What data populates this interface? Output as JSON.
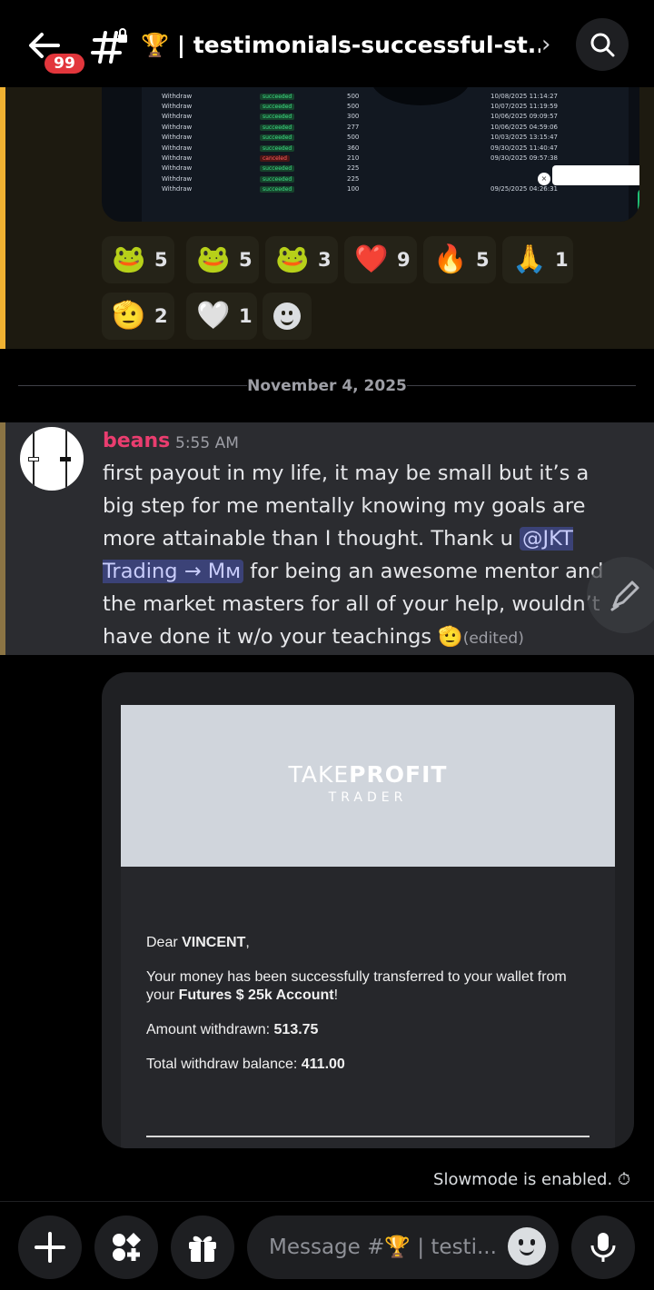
{
  "header": {
    "unread_badge": "99",
    "channel_emoji": "🏆",
    "channel_title": "| testimonials-successful-st...",
    "chevron": "›"
  },
  "previous_message": {
    "withdraw_table": [
      {
        "action": "Withdraw",
        "status": "succeeded",
        "amount": "500",
        "date": "10/08/2025 11:14:27"
      },
      {
        "action": "Withdraw",
        "status": "succeeded",
        "amount": "500",
        "date": "10/07/2025 11:19:59"
      },
      {
        "action": "Withdraw",
        "status": "succeeded",
        "amount": "300",
        "date": "10/06/2025 09:09:57"
      },
      {
        "action": "Withdraw",
        "status": "succeeded",
        "amount": "277",
        "date": "10/06/2025 04:59:06"
      },
      {
        "action": "Withdraw",
        "status": "succeeded",
        "amount": "500",
        "date": "10/03/2025 13:15:47"
      },
      {
        "action": "Withdraw",
        "status": "succeeded",
        "amount": "360",
        "date": "09/30/2025 11:40:47"
      },
      {
        "action": "Withdraw",
        "status": "canceled",
        "amount": "210",
        "date": "09/30/2025 09:57:38"
      },
      {
        "action": "Withdraw",
        "status": "succeeded",
        "amount": "225",
        "date": ""
      },
      {
        "action": "Withdraw",
        "status": "succeeded",
        "amount": "225",
        "date": ""
      },
      {
        "action": "Withdraw",
        "status": "succeeded",
        "amount": "100",
        "date": "09/25/2025 04:26:31"
      }
    ],
    "reactions": [
      {
        "emoji": "🐸",
        "count": "5"
      },
      {
        "emoji": "🐸",
        "count": "5"
      },
      {
        "emoji": "🐸",
        "count": "3"
      },
      {
        "emoji": "❤️",
        "count": "9"
      },
      {
        "emoji": "🔥",
        "count": "5"
      },
      {
        "emoji": "🙏",
        "count": "1"
      },
      {
        "emoji": "🫡",
        "count": "2"
      },
      {
        "emoji": "🤍",
        "count": "1"
      }
    ]
  },
  "date_divider": "November 4, 2025",
  "message": {
    "author": "beans",
    "time": "5:55 AM",
    "text_before_mention": "first payout in my life, it may be small but it’s a big step for me mentally knowing my goals are more attainable than I thought. Thank u ",
    "mention": "@JKT Trading → Mм",
    "text_after_mention": " for being an awesome mentor and the market masters for all of your help, wouldn’t have done it w/o your teachings ",
    "trailing_emoji": "🫡",
    "edited_label": "(edited)",
    "author_color": "#ea3d6f"
  },
  "email": {
    "logo_light": "TAKE",
    "logo_bold": "PROFIT",
    "logo_sub": "TRADER",
    "greeting_prefix": "Dear ",
    "greeting_name": "VINCENT",
    "greeting_suffix": ",",
    "line1": "Your money has been successfully transferred to your wallet from your ",
    "account": "Futures $ 25k Account",
    "line1_end": "!",
    "withdrawn_label": "Amount withdrawn: ",
    "withdrawn_value": "513.75",
    "balance_label": "Total withdraw balance: ",
    "balance_value": "411.00"
  },
  "slowmode_text": "Slowmode is enabled.",
  "composer": {
    "placeholder": "Message #🏆 | testi..."
  }
}
